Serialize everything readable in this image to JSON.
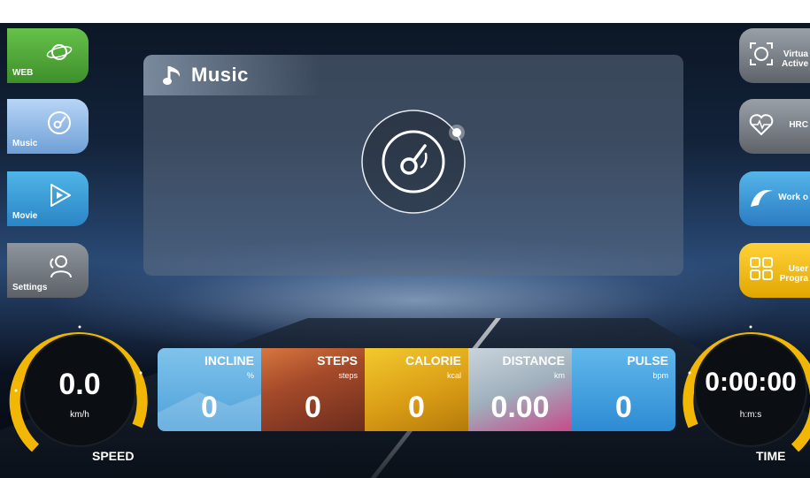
{
  "left_menu": {
    "web": "WEB",
    "music": "Music",
    "movie": "Movie",
    "settings": "Settings"
  },
  "right_menu": {
    "virtual_line1": "Virtua",
    "virtual_line2": "Active",
    "hrc": "HRC",
    "workout": "Work o",
    "user_line1": "User",
    "user_line2": "Progra"
  },
  "panel": {
    "title": "Music"
  },
  "speed": {
    "value": "0.0",
    "unit": "km/h",
    "caption": "SPEED"
  },
  "time": {
    "value": "0:00:00",
    "unit": "h:m:s",
    "caption": "TIME"
  },
  "stats": {
    "incline": {
      "label": "INCLINE",
      "unit": "%",
      "value": "0"
    },
    "steps": {
      "label": "STEPS",
      "unit": "steps",
      "value": "0"
    },
    "calorie": {
      "label": "CALORIE",
      "unit": "kcal",
      "value": "0"
    },
    "distance": {
      "label": "DISTANCE",
      "unit": "km",
      "value": "0.00"
    },
    "pulse": {
      "label": "PULSE",
      "unit": "bpm",
      "value": "0"
    }
  },
  "colors": {
    "accent_yellow": "#f2b705",
    "web_green": "#4fa83a",
    "music_blue": "#8fb8e6",
    "movie_blue": "#3aa0dd",
    "user_yellow": "#f3c11c"
  }
}
